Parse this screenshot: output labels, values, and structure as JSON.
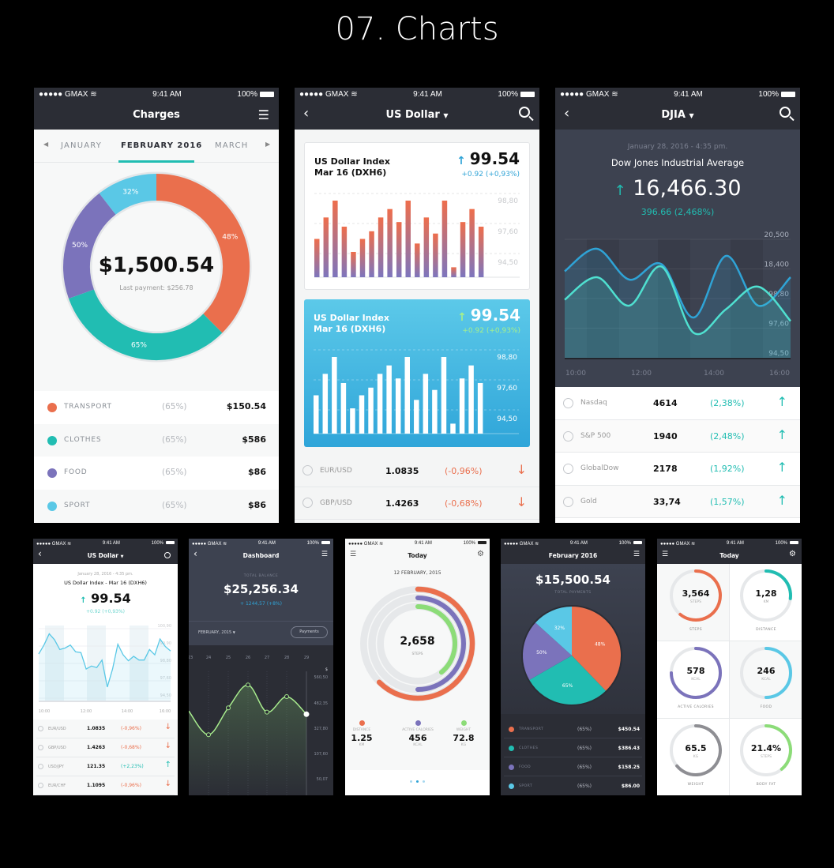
{
  "page_title": "07. Charts",
  "status": {
    "carrier": "GMAX",
    "time": "9:41 AM",
    "battery": "100%"
  },
  "colors": {
    "dark": "#2b2d35",
    "slate": "#3d4250",
    "orange": "#ea6f4d",
    "teal": "#21bdb2",
    "purple": "#7b73bb",
    "cyan": "#5ac8e6",
    "green": "#8cdc78",
    "red": "#ea6f4d"
  },
  "charges": {
    "title": "Charges",
    "tabs": [
      "JANUARY",
      "FEBRUARY 2016",
      "MARCH"
    ],
    "active_tab": 1,
    "total": "$1,500.54",
    "last_payment": "Last payment: $256.78",
    "chart_data": {
      "type": "pie",
      "donut": true,
      "slices": [
        {
          "label": "48%",
          "share": 0.375,
          "color": "#ea6f4d"
        },
        {
          "label": "65%",
          "share": 0.32,
          "color": "#21bdb2"
        },
        {
          "label": "50%",
          "share": 0.2,
          "color": "#7b73bb"
        },
        {
          "label": "32%",
          "share": 0.105,
          "color": "#5ac8e6"
        }
      ]
    },
    "legend": [
      {
        "name": "TRANSPORT",
        "pct": "(65%)",
        "amount": "$150.54",
        "color": "#ea6f4d"
      },
      {
        "name": "CLOTHES",
        "pct": "(65%)",
        "amount": "$586",
        "color": "#21bdb2"
      },
      {
        "name": "FOOD",
        "pct": "(65%)",
        "amount": "$86",
        "color": "#7b73bb"
      },
      {
        "name": "SPORT",
        "pct": "(65%)",
        "amount": "$86",
        "color": "#5ac8e6"
      }
    ]
  },
  "usd": {
    "title": "US Dollar",
    "cards": [
      {
        "name1": "US Dollar Index",
        "name2": "Mar 16 (DXH6)",
        "value": "99.54",
        "change": "+0.92 (+0,93%)",
        "style": "white"
      },
      {
        "name1": "US Dollar Index",
        "name2": "Mar 16 (DXH6)",
        "value": "99.54",
        "change": "+0.92 (+0,93%)",
        "style": "blue"
      }
    ],
    "chart_data": {
      "type": "bar",
      "yticks": [
        "98,80",
        "97,60",
        "94,50"
      ],
      "values": [
        50,
        78,
        100,
        66,
        33,
        50,
        60,
        78,
        89,
        72,
        100,
        44,
        78,
        57,
        100,
        13,
        72,
        89,
        66
      ]
    },
    "rows": [
      {
        "pair": "EUR/USD",
        "value": "1.0835",
        "change": "(-0,96%)",
        "dir": "down"
      },
      {
        "pair": "GBP/USD",
        "value": "1.4263",
        "change": "(-0,68%)",
        "dir": "down"
      }
    ]
  },
  "djia": {
    "title": "DJIA",
    "date": "January 28, 2016 - 4:35 pm.",
    "name": "Dow Jones Industrial Average",
    "value": "16,466.30",
    "change": "396.66 (2,468%)",
    "chart_data": {
      "type": "line",
      "yticks": [
        "20,500",
        "18,400",
        "98,80",
        "97,60",
        "94,50"
      ],
      "xticks": [
        "10:00",
        "12:00",
        "14:00",
        "16:00"
      ],
      "series": [
        {
          "color": "#2fa3d6",
          "values": [
            73,
            92,
            66,
            79,
            34,
            86,
            44,
            68
          ]
        },
        {
          "color": "#4fe0d0",
          "values": [
            49,
            68,
            44,
            77,
            21,
            41,
            60,
            31
          ]
        }
      ]
    },
    "rows": [
      {
        "name": "Nasdaq",
        "value": "4614",
        "change": "(2,38%)"
      },
      {
        "name": "S&P 500",
        "value": "1940",
        "change": "(2,48%)"
      },
      {
        "name": "GlobalDow",
        "value": "2178",
        "change": "(1,92%)"
      },
      {
        "name": "Gold",
        "value": "33,74",
        "change": "(1,57%)"
      }
    ]
  },
  "usd_small": {
    "title": "US Dollar",
    "date": "January 28, 2016 - 4:35 pm.",
    "name": "US Dollar Index - Mar 16 (DXH6)",
    "value": "99.54",
    "change": "+0.92 (+0,93%)",
    "chart_data": {
      "type": "line",
      "yticks": [
        "100,90",
        "99,90",
        "98,80",
        "97,60",
        "94,50"
      ],
      "xticks": [
        "10:00",
        "12:00",
        "14:00",
        "16:00"
      ],
      "values": [
        62,
        74,
        89,
        81,
        68,
        70,
        74,
        65,
        64,
        42,
        46,
        44,
        54,
        18,
        42,
        75,
        61,
        53,
        59,
        54,
        54,
        68,
        61,
        82,
        72,
        66
      ]
    },
    "rows": [
      {
        "pair": "EUR/USD",
        "value": "1.0835",
        "change": "(-0,96%)",
        "dir": "down"
      },
      {
        "pair": "GBP/USD",
        "value": "1.4263",
        "change": "(-0,68%)",
        "dir": "down"
      },
      {
        "pair": "USD/JPY",
        "value": "121.35",
        "change": "(+2,23%)",
        "dir": "up"
      },
      {
        "pair": "EUR/CHF",
        "value": "1.1095",
        "change": "(-0,96%)",
        "dir": "down"
      }
    ]
  },
  "dashboard": {
    "title": "Dashboard",
    "balance_label": "TOTAL BALANCE",
    "balance": "$25,256.34",
    "change": "+ 1244,57 (+8%)",
    "period": "FEBRUARY, 2015",
    "payments_button": "Payments",
    "chart_data": {
      "type": "line",
      "xticks": [
        "23",
        "24",
        "25",
        "26",
        "27",
        "28",
        "29"
      ],
      "yunit": "$",
      "yticks": [
        560.5,
        482.35,
        327.8,
        107.6,
        50.07
      ],
      "ytick_labels": [
        "560,50",
        "482,35",
        "327,80",
        "107,60",
        "50,07"
      ],
      "values": [
        442.5,
        284.7,
        462,
        541,
        436,
        506,
        423
      ]
    }
  },
  "activity": {
    "title": "Today",
    "date": "12 FEBRUARY, 2015",
    "steps": "2,658",
    "steps_label": "STEPS",
    "rings": [
      {
        "color": "#ea6f4d",
        "progress": 0.625
      },
      {
        "color": "#7b73bb",
        "progress": 0.5
      },
      {
        "color": "#8cdc78",
        "progress": 0.39
      }
    ],
    "stats": [
      {
        "label": "DISTANCE",
        "value": "1.25",
        "unit": "KM",
        "color": "#ea6f4d"
      },
      {
        "label": "ACTIVE CALORIES",
        "value": "456",
        "unit": "KCAL",
        "color": "#7b73bb"
      },
      {
        "label": "WEIGHT",
        "value": "72.8",
        "unit": "KG",
        "color": "#8cdc78"
      }
    ],
    "page_index": 1,
    "page_count": 3
  },
  "payments": {
    "title": "February 2016",
    "total": "$15,500.54",
    "total_label": "TOTAL PAYMENTS",
    "chart_data": {
      "type": "pie",
      "slices": [
        {
          "label": "48%",
          "share": 0.378,
          "color": "#ea6f4d"
        },
        {
          "label": "65%",
          "share": 0.289,
          "color": "#21bdb2"
        },
        {
          "label": "50%",
          "share": 0.2,
          "color": "#7b73bb"
        },
        {
          "label": "32%",
          "share": 0.133,
          "color": "#5ac8e6"
        }
      ]
    },
    "legend": [
      {
        "name": "TRANSPORT",
        "pct": "(65%)",
        "amount": "$450.54",
        "color": "#ea6f4d"
      },
      {
        "name": "CLOTHES",
        "pct": "(65%)",
        "amount": "$386.43",
        "color": "#21bdb2"
      },
      {
        "name": "FOOD",
        "pct": "(65%)",
        "amount": "$158.25",
        "color": "#7b73bb"
      },
      {
        "name": "SPORT",
        "pct": "(65%)",
        "amount": "$86.00",
        "color": "#5ac8e6"
      }
    ]
  },
  "today_grid": {
    "title": "Today",
    "tiles": [
      {
        "value": "3,564",
        "unit": "STEPS",
        "label": "STEPS",
        "progress": 0.61,
        "color": "#ea6f4d"
      },
      {
        "value": "1,28",
        "unit": "KM",
        "label": "DISTANCE",
        "progress": 0.27,
        "color": "#21bdb2"
      },
      {
        "value": "578",
        "unit": "KCAL",
        "label": "ACTIVE CALORIES",
        "progress": 0.75,
        "color": "#7b73bb"
      },
      {
        "value": "246",
        "unit": "KCAL",
        "label": "FOOD",
        "progress": 0.5,
        "color": "#5ac8e6"
      },
      {
        "value": "65.5",
        "unit": "KG",
        "label": "WEIGHT",
        "progress": 0.64,
        "color": "#8e8e93"
      },
      {
        "value": "21.4%",
        "unit": "STEPS",
        "label": "BODY FAT",
        "progress": 0.39,
        "color": "#8cdc78"
      }
    ]
  }
}
